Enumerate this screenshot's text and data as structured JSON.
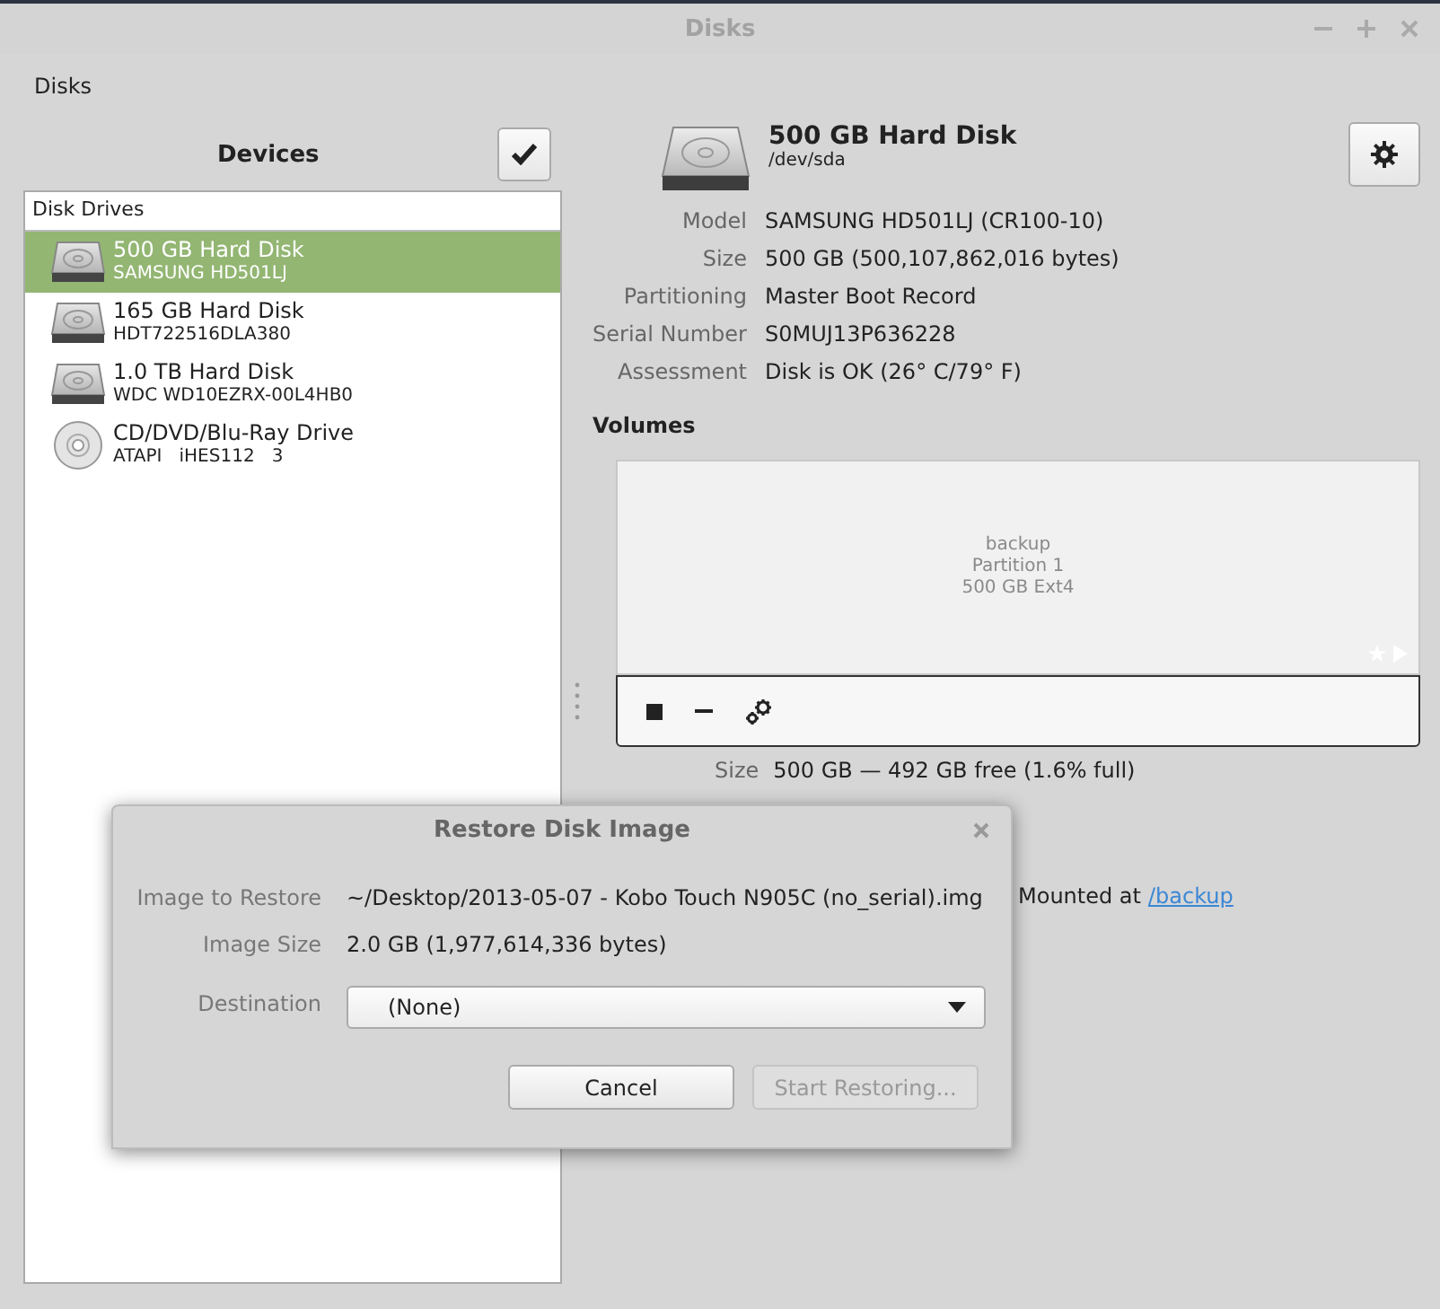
{
  "window": {
    "title": "Disks"
  },
  "app_menu": "Disks",
  "devices": {
    "title": "Devices",
    "list_header": "Disk Drives",
    "items": [
      {
        "name": "500 GB Hard Disk",
        "model": "SAMSUNG HD501LJ",
        "kind": "hdd",
        "selected": true
      },
      {
        "name": "165 GB Hard Disk",
        "model": "HDT722516DLA380",
        "kind": "hdd",
        "selected": false
      },
      {
        "name": "1.0 TB Hard Disk",
        "model": "WDC WD10EZRX-00L4HB0",
        "kind": "hdd",
        "selected": false
      },
      {
        "name": "CD/DVD/Blu-Ray Drive",
        "model": "ATAPI   iHES112   3",
        "kind": "optical",
        "selected": false
      }
    ]
  },
  "disk": {
    "title": "500 GB Hard Disk",
    "device": "/dev/sda",
    "properties": [
      {
        "label": "Model",
        "value": "SAMSUNG HD501LJ (CR100-10)"
      },
      {
        "label": "Size",
        "value": "500 GB (500,107,862,016 bytes)"
      },
      {
        "label": "Partitioning",
        "value": "Master Boot Record"
      },
      {
        "label": "Serial Number",
        "value": "S0MUJ13P636228"
      },
      {
        "label": "Assessment",
        "value": "Disk is OK (26° C/79° F)"
      }
    ]
  },
  "volumes": {
    "title": "Volumes",
    "partition_lines": [
      "backup",
      "Partition 1",
      "500 GB Ext4"
    ],
    "size_label": "Size",
    "size_value": "500 GB — 492 GB free (1.6% full)",
    "mount_text": "Mounted at",
    "mount_link": "/backup"
  },
  "dialog": {
    "title": "Restore Disk Image",
    "fields": [
      {
        "label": "Image to Restore",
        "value": "~/Desktop/2013-05-07 - Kobo Touch N905C (no_serial).img"
      },
      {
        "label": "Image Size",
        "value": "2.0 GB (1,977,614,336 bytes)"
      }
    ],
    "destination": {
      "label": "Destination",
      "value": "(None)"
    },
    "buttons": [
      {
        "label": "Cancel",
        "disabled": false
      },
      {
        "label": "Start Restoring...",
        "disabled": true
      }
    ]
  }
}
